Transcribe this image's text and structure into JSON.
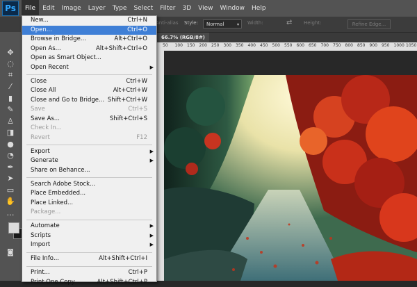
{
  "app": {
    "logo": "Ps"
  },
  "menubar": {
    "items": [
      "File",
      "Edit",
      "Image",
      "Layer",
      "Type",
      "Select",
      "Filter",
      "3D",
      "View",
      "Window",
      "Help"
    ],
    "active": "File"
  },
  "options": {
    "antialias": "Anti-alias",
    "style_label": "Style:",
    "style_value": "Normal",
    "width_label": "Width:",
    "height_label": "Height:",
    "refine_edge": "Refine Edge..."
  },
  "document": {
    "tab": "66.7% (RGB/8#)"
  },
  "ruler": {
    "ticks": [
      "50",
      "100",
      "150",
      "200",
      "250",
      "300",
      "350",
      "400",
      "450",
      "500",
      "550",
      "600",
      "650",
      "700",
      "750",
      "800",
      "850",
      "900",
      "950",
      "1000",
      "1050"
    ]
  },
  "file_menu": {
    "items": [
      {
        "label": "New...",
        "shortcut": "Ctrl+N"
      },
      {
        "label": "Open...",
        "shortcut": "Ctrl+O",
        "highlighted": true
      },
      {
        "label": "Browse in Bridge...",
        "shortcut": "Alt+Ctrl+O"
      },
      {
        "label": "Open As...",
        "shortcut": "Alt+Shift+Ctrl+O"
      },
      {
        "label": "Open as Smart Object..."
      },
      {
        "label": "Open Recent",
        "submenu": true
      },
      {
        "separator": true
      },
      {
        "label": "Close",
        "shortcut": "Ctrl+W"
      },
      {
        "label": "Close All",
        "shortcut": "Alt+Ctrl+W"
      },
      {
        "label": "Close and Go to Bridge...",
        "shortcut": "Shift+Ctrl+W"
      },
      {
        "label": "Save",
        "shortcut": "Ctrl+S",
        "disabled": true
      },
      {
        "label": "Save As...",
        "shortcut": "Shift+Ctrl+S"
      },
      {
        "label": "Check In...",
        "disabled": true
      },
      {
        "label": "Revert",
        "shortcut": "F12",
        "disabled": true
      },
      {
        "separator": true
      },
      {
        "label": "Export",
        "submenu": true
      },
      {
        "label": "Generate",
        "submenu": true
      },
      {
        "label": "Share on Behance..."
      },
      {
        "separator": true
      },
      {
        "label": "Search Adobe Stock..."
      },
      {
        "label": "Place Embedded..."
      },
      {
        "label": "Place Linked..."
      },
      {
        "label": "Package...",
        "disabled": true
      },
      {
        "separator": true
      },
      {
        "label": "Automate",
        "submenu": true
      },
      {
        "label": "Scripts",
        "submenu": true
      },
      {
        "label": "Import",
        "submenu": true
      },
      {
        "separator": true
      },
      {
        "label": "File Info...",
        "shortcut": "Alt+Shift+Ctrl+I"
      },
      {
        "separator": true
      },
      {
        "label": "Print...",
        "shortcut": "Ctrl+P"
      },
      {
        "label": "Print One Copy",
        "shortcut": "Alt+Shift+Ctrl+P"
      }
    ]
  },
  "tools": [
    {
      "icon": "move-icon",
      "glyph": "✥"
    },
    {
      "icon": "lasso-icon",
      "glyph": "◌"
    },
    {
      "icon": "crop-icon",
      "glyph": "⌗"
    },
    {
      "icon": "eyedropper-icon",
      "glyph": "⁄"
    },
    {
      "icon": "healing-brush-icon",
      "glyph": "▮"
    },
    {
      "icon": "brush-icon",
      "glyph": "✎"
    },
    {
      "icon": "clone-stamp-icon",
      "glyph": "♙"
    },
    {
      "icon": "eraser-icon",
      "glyph": "◨"
    },
    {
      "icon": "blur-icon",
      "glyph": "●"
    },
    {
      "icon": "dodge-icon",
      "glyph": "◔"
    },
    {
      "icon": "pen-icon",
      "glyph": "✒"
    },
    {
      "icon": "path-select-icon",
      "glyph": "➤"
    },
    {
      "icon": "rectangle-icon",
      "glyph": "▭"
    },
    {
      "icon": "hand-icon",
      "glyph": "✋"
    },
    {
      "icon": "more-tools-icon",
      "glyph": "…"
    }
  ],
  "colors": {
    "menubar": "#535353",
    "highlight": "#3f7fd6",
    "dropdown_bg": "#f0f0f0"
  }
}
